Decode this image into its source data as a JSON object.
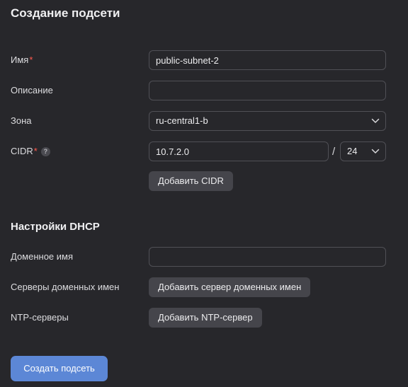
{
  "page": {
    "title": "Создание подсети"
  },
  "form": {
    "name": {
      "label": "Имя",
      "required_mark": "*",
      "value": "public-subnet-2"
    },
    "description": {
      "label": "Описание",
      "value": ""
    },
    "zone": {
      "label": "Зона",
      "value": "ru-central1-b"
    },
    "cidr": {
      "label": "CIDR",
      "required_mark": "*",
      "help": "?",
      "value": "10.7.2.0",
      "separator": "/",
      "prefix": "24",
      "add_button": "Добавить CIDR"
    }
  },
  "dhcp": {
    "title": "Настройки DHCP",
    "domain_name": {
      "label": "Доменное имя",
      "value": ""
    },
    "dns_servers": {
      "label": "Серверы доменных имен",
      "add_button": "Добавить сервер доменных имен"
    },
    "ntp_servers": {
      "label": "NTP-серверы",
      "add_button": "Добавить NTP-сервер"
    }
  },
  "actions": {
    "submit": "Создать подсеть"
  },
  "colors": {
    "background": "#27272b",
    "required": "#ff5a4f",
    "primary": "#5c87d6",
    "button": "#45454b",
    "border": "#505056"
  },
  "icons": {
    "dropdown": "chevron-down-icon",
    "help": "question-circle-icon"
  }
}
